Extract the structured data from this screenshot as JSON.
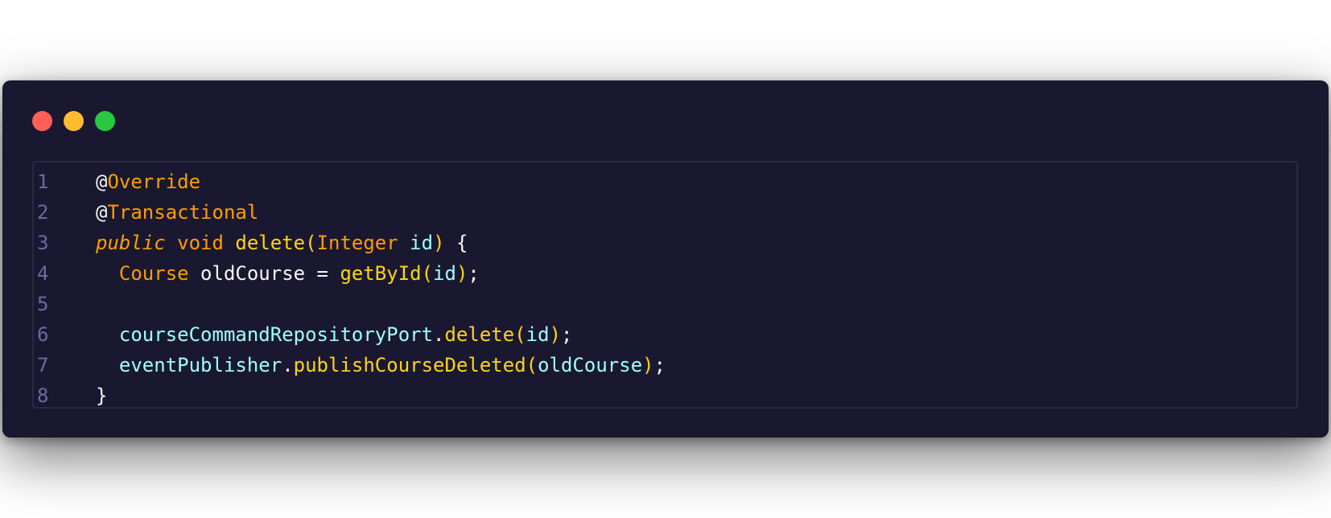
{
  "window": {
    "controls": {
      "close_color": "#ff5f57",
      "minimize_color": "#febc2e",
      "maximize_color": "#28c840"
    }
  },
  "theme": {
    "background": "#1a1830",
    "line_number": "#6c6aa3",
    "default_text": "#f8f8f2",
    "keyword": "#ff9d00",
    "function": "#ffd319",
    "variable": "#9effff"
  },
  "code_lines": [
    {
      "number": "1",
      "tokens": [
        {
          "text": "@",
          "kind": "default"
        },
        {
          "text": "Override",
          "kind": "keyword"
        }
      ]
    },
    {
      "number": "2",
      "tokens": [
        {
          "text": "@",
          "kind": "default"
        },
        {
          "text": "Transactional",
          "kind": "keyword"
        }
      ]
    },
    {
      "number": "3",
      "tokens": [
        {
          "text": "public",
          "kind": "keyword-italic"
        },
        {
          "text": " ",
          "kind": "default"
        },
        {
          "text": "void",
          "kind": "keyword"
        },
        {
          "text": " ",
          "kind": "default"
        },
        {
          "text": "delete",
          "kind": "func"
        },
        {
          "text": "(",
          "kind": "paren"
        },
        {
          "text": "Integer",
          "kind": "type"
        },
        {
          "text": " ",
          "kind": "default"
        },
        {
          "text": "id",
          "kind": "var"
        },
        {
          "text": ")",
          "kind": "paren"
        },
        {
          "text": " {",
          "kind": "punct"
        }
      ]
    },
    {
      "number": "4",
      "tokens": [
        {
          "text": "  ",
          "kind": "default"
        },
        {
          "text": "Course",
          "kind": "type"
        },
        {
          "text": " oldCourse = ",
          "kind": "default"
        },
        {
          "text": "getById",
          "kind": "func"
        },
        {
          "text": "(",
          "kind": "paren"
        },
        {
          "text": "id",
          "kind": "var"
        },
        {
          "text": ")",
          "kind": "paren"
        },
        {
          "text": ";",
          "kind": "punct"
        }
      ]
    },
    {
      "number": "5",
      "tokens": []
    },
    {
      "number": "6",
      "tokens": [
        {
          "text": "  ",
          "kind": "default"
        },
        {
          "text": "courseCommandRepositoryPort",
          "kind": "var"
        },
        {
          "text": ".",
          "kind": "punct"
        },
        {
          "text": "delete",
          "kind": "func"
        },
        {
          "text": "(",
          "kind": "paren"
        },
        {
          "text": "id",
          "kind": "var"
        },
        {
          "text": ")",
          "kind": "paren"
        },
        {
          "text": ";",
          "kind": "punct"
        }
      ]
    },
    {
      "number": "7",
      "tokens": [
        {
          "text": "  ",
          "kind": "default"
        },
        {
          "text": "eventPublisher",
          "kind": "var"
        },
        {
          "text": ".",
          "kind": "punct"
        },
        {
          "text": "publishCourseDeleted",
          "kind": "func"
        },
        {
          "text": "(",
          "kind": "paren"
        },
        {
          "text": "oldCourse",
          "kind": "var"
        },
        {
          "text": ")",
          "kind": "paren"
        },
        {
          "text": ";",
          "kind": "punct"
        }
      ]
    },
    {
      "number": "8",
      "tokens": [
        {
          "text": "}",
          "kind": "punct"
        }
      ]
    }
  ]
}
